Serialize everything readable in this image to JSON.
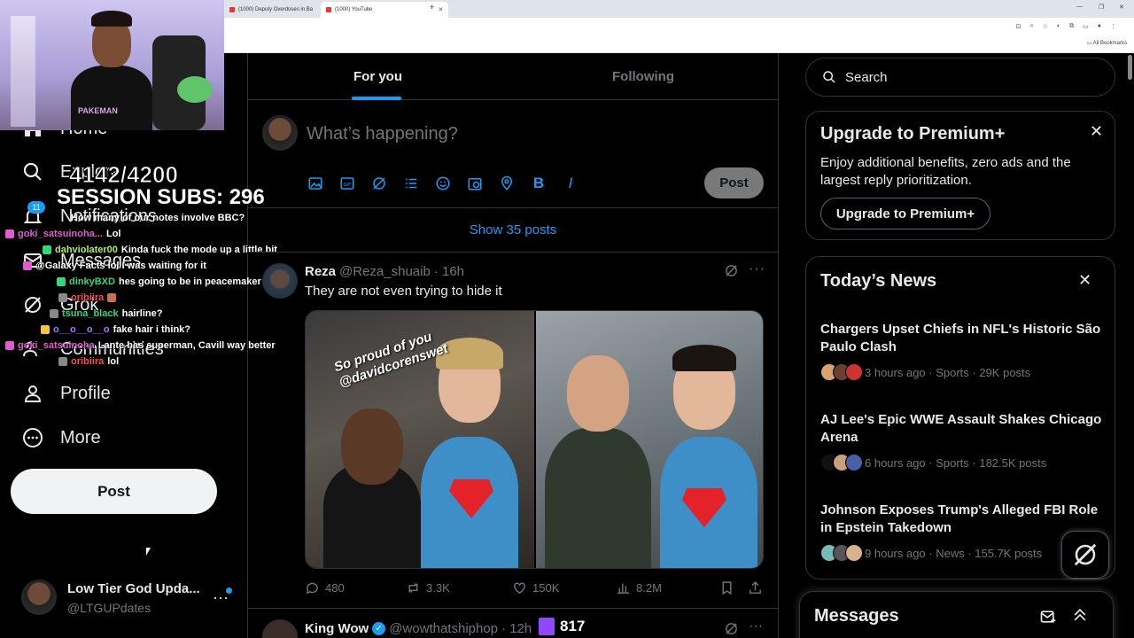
{
  "browser": {
    "tabs": [
      {
        "label": "(1000) Deputy Overdoses in Ba"
      },
      {
        "label": "(1000) YouTube"
      }
    ],
    "all_bookmarks": "All Bookmarks"
  },
  "stream": {
    "sub_goal": "4142/4200",
    "session_subs": "SESSION SUBS: 296",
    "shirt_text": "PAKEMAN",
    "chat": [
      {
        "user": "",
        "message": "How many of our notes involve BBC?",
        "color": "#ffffff"
      },
      {
        "user": "goki_satsuinoha...",
        "message": "Lol",
        "color": "#e05bd0"
      },
      {
        "user": "dahviolater00",
        "message": "Kinda fuck the mode up a little bit",
        "color": "#b5f23d"
      },
      {
        "user": "",
        "message": "@Galaxy Facts lol I was waiting for it",
        "color": "#ffffff"
      },
      {
        "user": "dinkyBXD",
        "message": "hes going to be in peacemaker",
        "color": "#2fd87a"
      },
      {
        "user": "oribiira",
        "message": "",
        "color": "#ff4d4d"
      },
      {
        "user": "tsuna_black",
        "message": "hairline?",
        "color": "#2fd87a"
      },
      {
        "user": "o__o__o__o",
        "message": "fake hair i think?",
        "color": "#a67bff"
      },
      {
        "user": "goki_satsuinoha",
        "message": "Lante has superman, Cavill way better",
        "color": "#e05bd0"
      },
      {
        "user": "oribiira",
        "message": "lol",
        "color": "#ff4d4d"
      }
    ],
    "twitch_count": "817"
  },
  "nav": {
    "items": [
      {
        "label": "Home",
        "icon": "home-icon"
      },
      {
        "label": "Explore",
        "icon": "search-icon"
      },
      {
        "label": "Notifications",
        "icon": "bell-icon"
      },
      {
        "label": "Messages",
        "icon": "mail-icon"
      },
      {
        "label": "Grok",
        "icon": "grok-icon"
      },
      {
        "label": "Communities",
        "icon": "people-icon"
      },
      {
        "label": "Profile",
        "icon": "person-icon"
      },
      {
        "label": "More",
        "icon": "more-circle-icon"
      }
    ],
    "notifications_badge": "11",
    "post_label": "Post"
  },
  "account": {
    "name": "Low Tier God Upda...",
    "handle": "@LTGUPdates"
  },
  "feed": {
    "tabs": [
      "For you",
      "Following"
    ],
    "composer_placeholder": "What’s happening?",
    "composer_post": "Post",
    "show_posts": "Show 35 posts",
    "tweet": {
      "name": "Reza",
      "handle": "@Reza_shuaib",
      "time": "· 16h",
      "text": "They are not even trying to hide it",
      "image_caption": "So proud of you @davidcorenswet",
      "replies": "480",
      "reposts": "3.3K",
      "likes": "150K",
      "views": "8.2M"
    },
    "tweet2": {
      "name": "King Wow",
      "handle": "@wowthatshiphop",
      "time": "· 12h"
    }
  },
  "sidebar": {
    "search_placeholder": "Search",
    "premium": {
      "title": "Upgrade to Premium+",
      "desc": "Enjoy additional benefits, zero ads and the largest reply prioritization.",
      "cta": "Upgrade to Premium+"
    },
    "news": {
      "title": "Today’s News",
      "items": [
        {
          "headline": "Chargers Upset Chiefs in NFL's Historic São Paulo Clash",
          "meta": "3 hours ago · Sports · 29K posts"
        },
        {
          "headline": "AJ Lee's Epic WWE Assault Shakes Chicago Arena",
          "meta": "6 hours ago · Sports · 182.5K posts"
        },
        {
          "headline": "Johnson Exposes Trump's Alleged FBI Role in Epstein Takedown",
          "meta": "9 hours ago · News · 155.7K posts"
        }
      ]
    },
    "messages_title": "Messages"
  },
  "colors": {
    "accent": "#1d9bf0",
    "background": "#000000",
    "text": "#e7e9ea",
    "muted": "#71767b",
    "border": "#2f3336"
  }
}
